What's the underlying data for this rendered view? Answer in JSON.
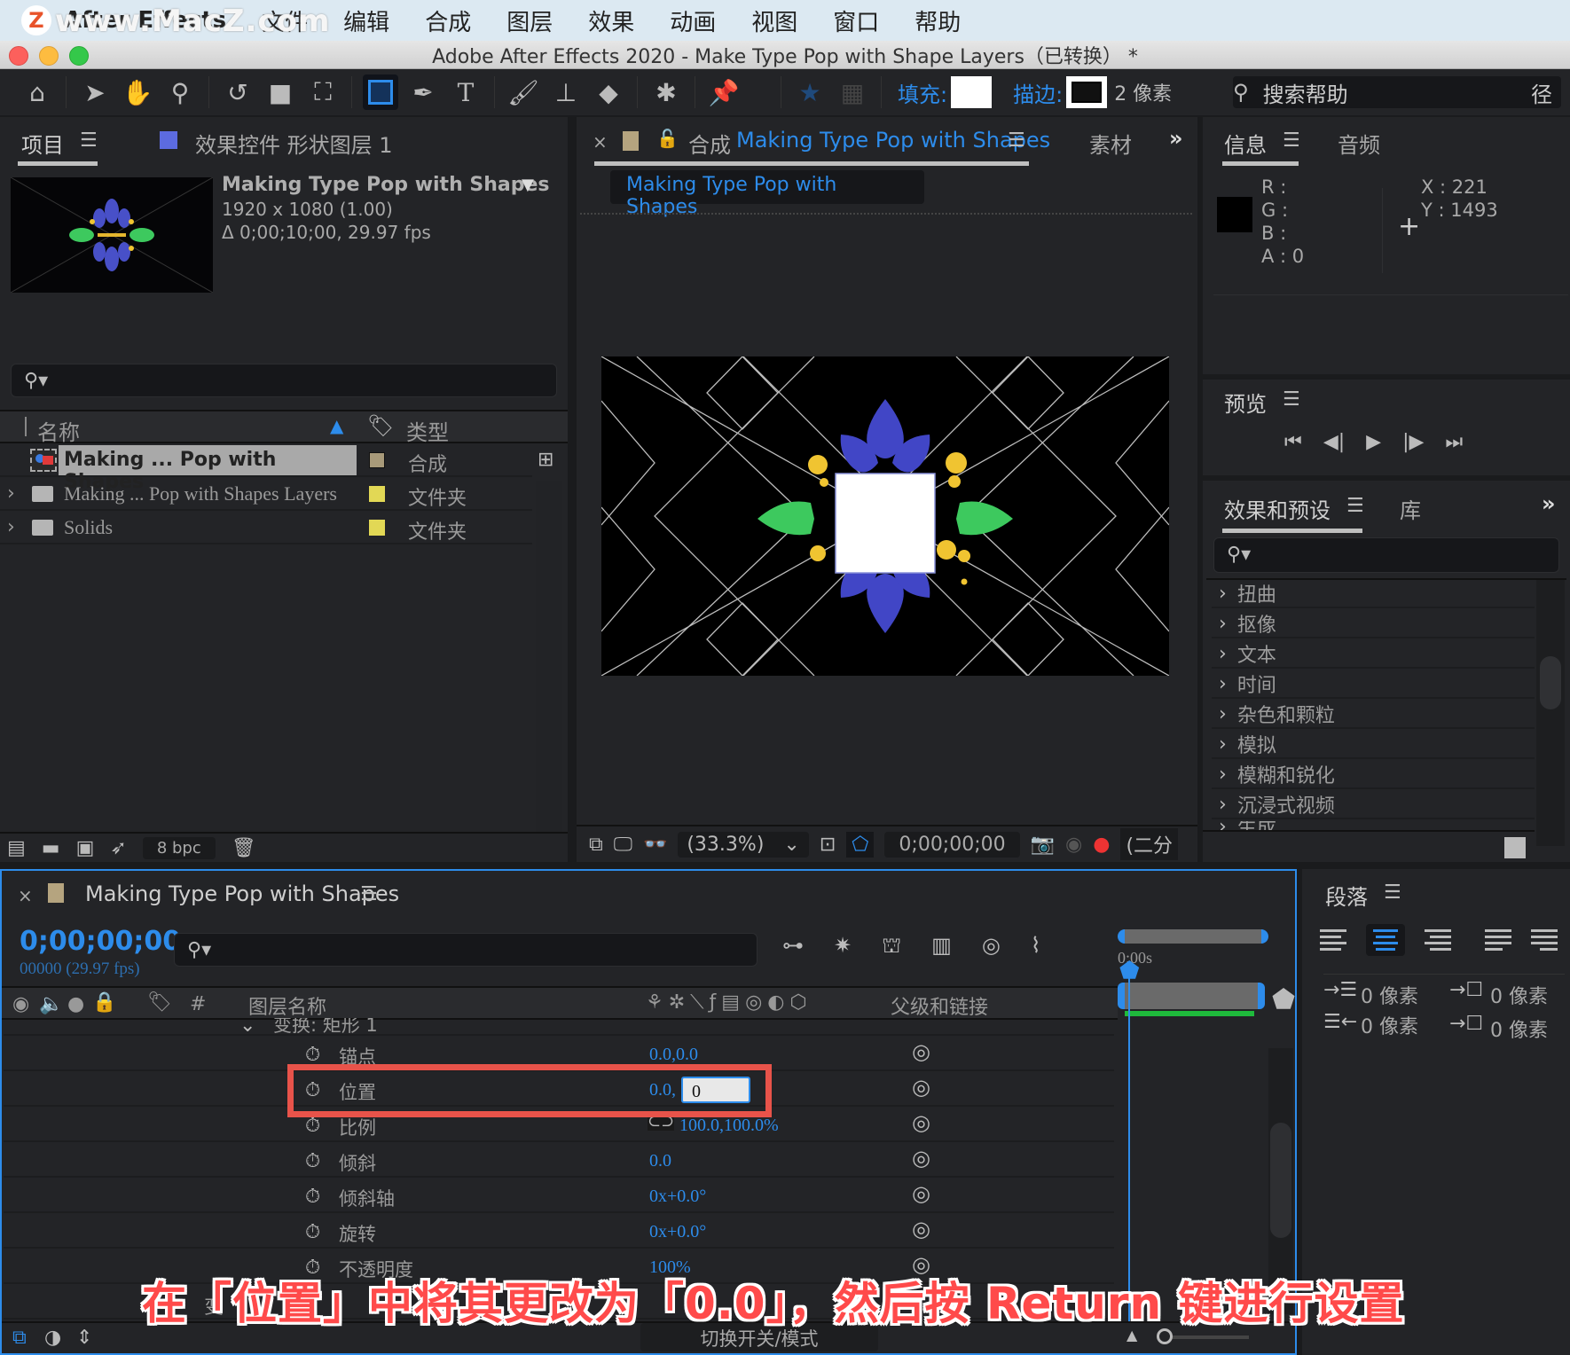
{
  "menubar": {
    "watermark": "www.MacZ.com",
    "app_name": "After Effects",
    "items": [
      "文件",
      "编辑",
      "合成",
      "图层",
      "效果",
      "动画",
      "视图",
      "窗口",
      "帮助"
    ]
  },
  "window": {
    "title": "Adobe After Effects 2020 - Make Type Pop with Shape Layers（已转换） *"
  },
  "toolbar": {
    "tools": [
      "home-icon",
      "selection-arrow-icon",
      "hand-icon",
      "zoom-icon",
      "rotate-icon",
      "camera-icon",
      "pan-behind-icon",
      "rectangle-icon",
      "pen-icon",
      "type-icon",
      "brush-icon",
      "clone-stamp-icon",
      "eraser-icon",
      "roto-brush-icon",
      "puppet-pin-icon"
    ],
    "fill_label": "填充:",
    "stroke_label": "描边:",
    "stroke_px": "2 像素",
    "search_help": "搜索帮助",
    "overflow": "径",
    "fill_color": "#ffffff",
    "stroke_color": "#111111"
  },
  "project_panel": {
    "tab_project": "项目",
    "tab_effects": "效果控件 形状图层 1",
    "effects_swatch": "#5c6be0",
    "comp_name": "Making Type Pop with Shapes",
    "comp_size": "1920 x 1080 (1.00)",
    "comp_duration": "Δ 0;00;10;00, 29.97 fps",
    "col_name": "名称",
    "col_type": "类型",
    "items": [
      {
        "name": "Making ... Pop with Shapes",
        "type": "合成",
        "color": "#a89a7a",
        "selected": true,
        "kind": "composition"
      },
      {
        "name": "Making ... Pop with Shapes Layers",
        "type": "文件夹",
        "color": "#e2d855",
        "selected": false,
        "kind": "folder"
      },
      {
        "name": "Solids",
        "type": "文件夹",
        "color": "#e2d855",
        "selected": false,
        "kind": "folder"
      }
    ],
    "bpc": "8 bpc"
  },
  "comp_panel": {
    "tab_prefix": "合成",
    "tab_name": "Making Type Pop with Shapes",
    "tab_footage": "素材",
    "breadcrumb": "Making Type Pop with Shapes",
    "zoom": "(33.3%)",
    "timecode": "0;00;00;00",
    "resolution": "(二分"
  },
  "info_panel": {
    "tab_info": "信息",
    "tab_audio": "音频",
    "r": "R :",
    "g": "G :",
    "b": "B :",
    "a": "A :  0",
    "x": "X : 221",
    "y": "Y :  1493"
  },
  "preview_panel": {
    "title": "预览"
  },
  "effects_panel": {
    "tab_effects": "效果和预设",
    "tab_library": "库",
    "categories": [
      "扭曲",
      "抠像",
      "文本",
      "时间",
      "杂色和颗粒",
      "模拟",
      "模糊和锐化",
      "沉浸式视频",
      "生成"
    ]
  },
  "timeline": {
    "comp_name": "Making Type Pop with Shapes",
    "timecode": "0;00;00;00",
    "frame_info": "00000 (29.97 fps)",
    "col_layer_name": "图层名称",
    "col_parent": "父级和链接",
    "ruler_label": "0:00s",
    "group_label": "变换: 矩形 1",
    "properties": [
      {
        "name": "锚点",
        "value": "0.0,0.0"
      },
      {
        "name": "位置",
        "value": "0.0,",
        "editing_value": "0"
      },
      {
        "name": "比例",
        "value": "100.0,100.0%"
      },
      {
        "name": "倾斜",
        "value": "0.0"
      },
      {
        "name": "倾斜轴",
        "value": "0x+0.0°"
      },
      {
        "name": "旋转",
        "value": "0x+0.0°"
      },
      {
        "name": "不透明度",
        "value": "100%"
      }
    ],
    "partial_row": "变",
    "toggle_label": "切换开关/模式"
  },
  "paragraph_panel": {
    "title": "段落",
    "indent_left": "0 像素",
    "indent_right": "0 像素",
    "space_before": "0 像素",
    "space_after": "0 像素"
  },
  "caption": "在「位置」中将其更改为「0.0」，然后按 Return 键进行设置",
  "colors": {
    "accent": "#2d8ceb",
    "highlight": "#e8534a",
    "panel": "#232427"
  }
}
